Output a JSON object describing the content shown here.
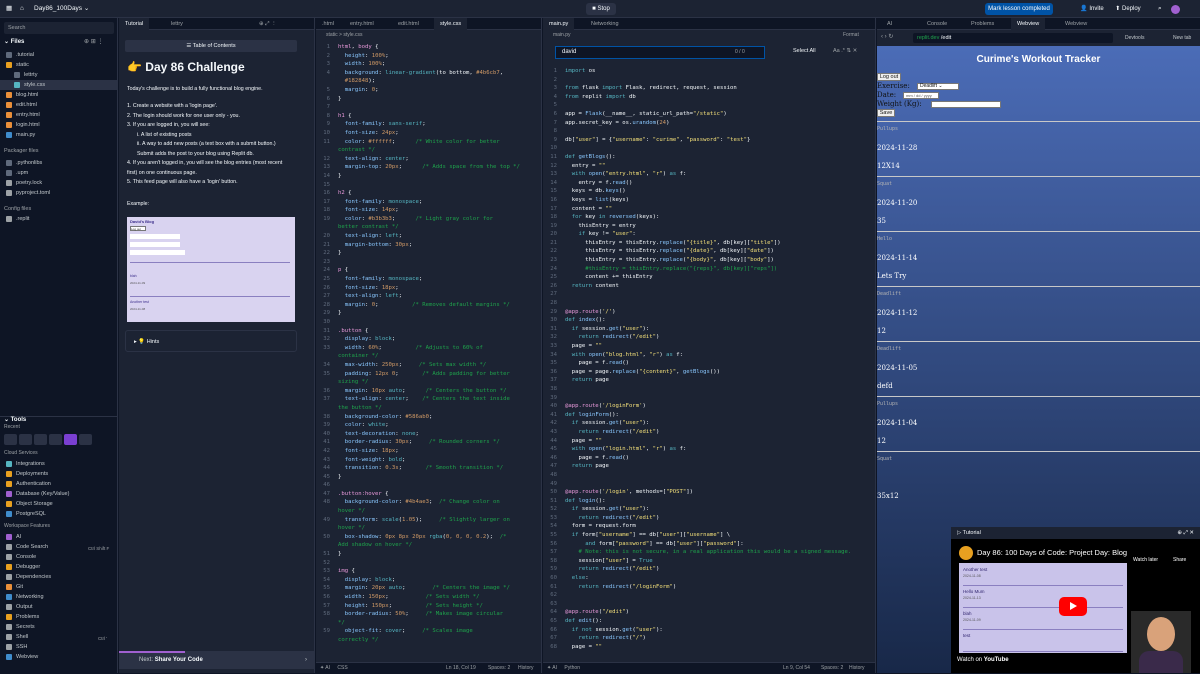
{
  "topbar": {
    "search": "Search",
    "project": "Day86_100Days",
    "stop": "Stop",
    "mark": "Mark lesson completed",
    "invite": "Invite",
    "deploy": "Deploy"
  },
  "sidebar": {
    "files_title": "Files",
    "files": [
      ".tutorial",
      "static",
      "lettrty",
      "style.css",
      "blog.html",
      "edit.html",
      "entry.html",
      "login.html",
      "main.py"
    ],
    "packager_title": "Packager files",
    "packager": [
      ".pythonlibs",
      ".upm",
      "poetry.lock",
      "pyproject.toml"
    ],
    "config_title": "Config files",
    "config": [
      ".replit"
    ],
    "tools_title": "Tools",
    "recent": "Recent",
    "cloud_title": "Cloud Services",
    "cloud": [
      "Integrations",
      "Deployments",
      "Authentication",
      "Database (Key/Value)",
      "Object Storage",
      "PostgreSQL"
    ],
    "workspace_title": "Workspace Features",
    "workspace": [
      "AI",
      "Code Search",
      "Console",
      "Debugger",
      "Dependencies",
      "Git",
      "Networking",
      "Output",
      "Problems",
      "Secrets",
      "Shell",
      "SSH",
      "Webview"
    ],
    "code_search_shortcut": "Ctrl Shift F",
    "shell_shortcut": "Ctrl '"
  },
  "tutorial": {
    "tabs": [
      "Tutorial",
      "lettry"
    ],
    "toc": "Table of Contents",
    "heading": "Day 86 Challenge",
    "intro": "Today's challenge is to build a fully functional blog engine.",
    "steps": [
      "1. Create a website with a 'login page'.",
      "2. The login should work for one user only - you.",
      "3. If you are logged in, you will see:",
      "i. A list of existing posts",
      "ii. A way to add new posts (a text box with a submit button.) Submit adds the post to your blog using Replit db.",
      "4. If you aren't logged in, you will see the blog entries (most recent first) on one continuous page.",
      "5. This feed page will also have a 'login' button."
    ],
    "example": "Example:",
    "hints": "Hints",
    "next": "Next:",
    "next_title": "Share Your Code",
    "thumb": {
      "title": "David's Blog",
      "logout": "Log out",
      "entry1": "blah",
      "date1": "2024-11-09",
      "entry2": "Another test",
      "date2": "2024-11-08"
    }
  },
  "css_editor": {
    "tabs": [
      ".html",
      "entry.html",
      "edit.html",
      "style.css"
    ],
    "breadcrumb": "static > style.css",
    "status": "Ln 18, Col 19",
    "spaces": "Spaces: 2",
    "history": "History",
    "lang": "CSS"
  },
  "py_editor": {
    "tabs": [
      "main.py",
      "Networking"
    ],
    "search_value": "david",
    "search_count": "0 / 0",
    "select_all": "Select All",
    "breadcrumb": "main.py",
    "format": "Format",
    "status": "Ln 9, Col 54",
    "spaces": "Spaces: 2",
    "history": "History",
    "lang": "Python"
  },
  "webview": {
    "tabs": [
      "AI",
      "Console",
      "Problems",
      "Webview",
      "Webview"
    ],
    "url_domain": "replit.dev",
    "url_path": "/edit",
    "devtools": "Devtools",
    "new_tab": "New tab",
    "app_title": "Curime's Workout Tracker",
    "logout": "Log out",
    "exercise_label": "Exercise:",
    "exercise_value": "Deadlift",
    "date_label": "Date:",
    "date_placeholder": "mm / dd / yyyy",
    "weight_label": "Weight (Kg):",
    "save": "Save",
    "entries": [
      {
        "title": "Pullups",
        "date": "2024-11-28",
        "body": "12X14"
      },
      {
        "title": "Squat",
        "date": "2024-11-20",
        "body": "35"
      },
      {
        "title": "Hello",
        "date": "2024-11-14",
        "body": "Lets Try"
      },
      {
        "title": "Deadlift",
        "date": "2024-11-12",
        "body": "12"
      },
      {
        "title": "Deadlift",
        "date": "2024-11-05",
        "body": "defd"
      },
      {
        "title": "Pullups",
        "date": "2024-11-04",
        "body": "12"
      },
      {
        "title": "Squat",
        "date": "",
        "body": "35x12"
      }
    ]
  },
  "video": {
    "tab": "Tutorial",
    "title": "Day 86: 100 Days of Code: Project Day: Blog",
    "watch_later": "Watch later",
    "share": "Share",
    "watch_on": "Watch on",
    "youtube": "YouTube",
    "blog": [
      {
        "t": "Another test",
        "d": "2024-11-08"
      },
      {
        "t": "Hello Mum",
        "d": "2024-11-13"
      },
      {
        "t": "blah",
        "d": "2024-11-09"
      },
      {
        "t": "test",
        "d": ""
      }
    ]
  },
  "colors": {
    "accent": "#0053a6",
    "bg": "#0e1525",
    "panel": "#1c2333",
    "gradTop": "#4b6cb7",
    "gradBottom": "#182848"
  }
}
